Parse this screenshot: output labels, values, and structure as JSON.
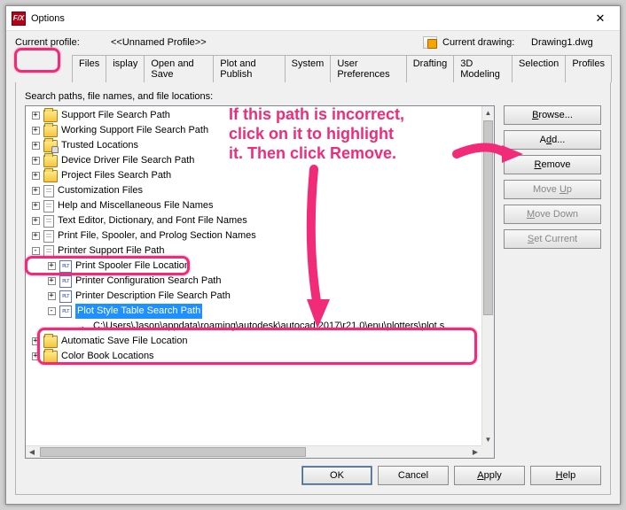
{
  "window": {
    "title": "Options",
    "app_icon_text": "F/X"
  },
  "profile": {
    "current_profile_label": "Current profile:",
    "current_profile_value": "<<Unnamed Profile>>",
    "current_drawing_label": "Current drawing:",
    "current_drawing_value": "Drawing1.dwg"
  },
  "tabs": {
    "items": [
      {
        "label": "Files",
        "active": true
      },
      {
        "label": "isplay"
      },
      {
        "label": "Open and Save"
      },
      {
        "label": "Plot and Publish"
      },
      {
        "label": "System"
      },
      {
        "label": "User Preferences"
      },
      {
        "label": "Drafting"
      },
      {
        "label": "3D Modeling"
      },
      {
        "label": "Selection"
      },
      {
        "label": "Profiles"
      }
    ]
  },
  "panel": {
    "label": "Search paths, file names, and file locations:"
  },
  "tree": {
    "items": [
      {
        "depth": 1,
        "pm": "+",
        "icon": "folder",
        "label": "Support File Search Path"
      },
      {
        "depth": 1,
        "pm": "+",
        "icon": "folder",
        "label": "Working Support File Search Path"
      },
      {
        "depth": 1,
        "pm": "+",
        "icon": "folder-locked",
        "label": "Trusted Locations"
      },
      {
        "depth": 1,
        "pm": "+",
        "icon": "folder",
        "label": "Device Driver File Search Path"
      },
      {
        "depth": 1,
        "pm": "+",
        "icon": "folder",
        "label": "Project Files Search Path"
      },
      {
        "depth": 1,
        "pm": "+",
        "icon": "doc",
        "label": "Customization Files"
      },
      {
        "depth": 1,
        "pm": "+",
        "icon": "doc",
        "label": "Help and Miscellaneous File Names"
      },
      {
        "depth": 1,
        "pm": "+",
        "icon": "doc",
        "label": "Text Editor, Dictionary, and Font File Names"
      },
      {
        "depth": 1,
        "pm": "+",
        "icon": "doc",
        "label": "Print File, Spooler, and Prolog Section Names"
      },
      {
        "depth": 1,
        "pm": "-",
        "icon": "doc",
        "label": "Printer Support File Path"
      },
      {
        "depth": 2,
        "pm": "+",
        "icon": "plt",
        "label": "Print Spooler File Location"
      },
      {
        "depth": 2,
        "pm": "+",
        "icon": "plt",
        "label": "Printer Configuration Search Path"
      },
      {
        "depth": 2,
        "pm": "+",
        "icon": "plt",
        "label": "Printer Description File Search Path"
      },
      {
        "depth": 2,
        "pm": "-",
        "icon": "plt",
        "label": "Plot Style Table Search Path",
        "selected": true
      },
      {
        "depth": 3,
        "pm": "",
        "icon": "arrow",
        "label": "C:\\Users\\Jason\\appdata\\roaming\\autodesk\\autocad 2017\\r21.0\\enu\\plotters\\plot s"
      },
      {
        "depth": 1,
        "pm": "+",
        "icon": "folder",
        "label": "Automatic Save File Location"
      },
      {
        "depth": 1,
        "pm": "+",
        "icon": "folder",
        "label": "Color Book Locations"
      }
    ]
  },
  "side_buttons": {
    "browse": "Browse...",
    "add": "Add...",
    "remove": "Remove",
    "moveup": "Move Up",
    "movedown": "Move Down",
    "setcurrent": "Set Current"
  },
  "bottom_buttons": {
    "ok": "OK",
    "cancel": "Cancel",
    "apply": "Apply",
    "help": "Help"
  },
  "annotation": {
    "text": "If this path is incorrect, click on it to highlight it. Then click Remove."
  }
}
